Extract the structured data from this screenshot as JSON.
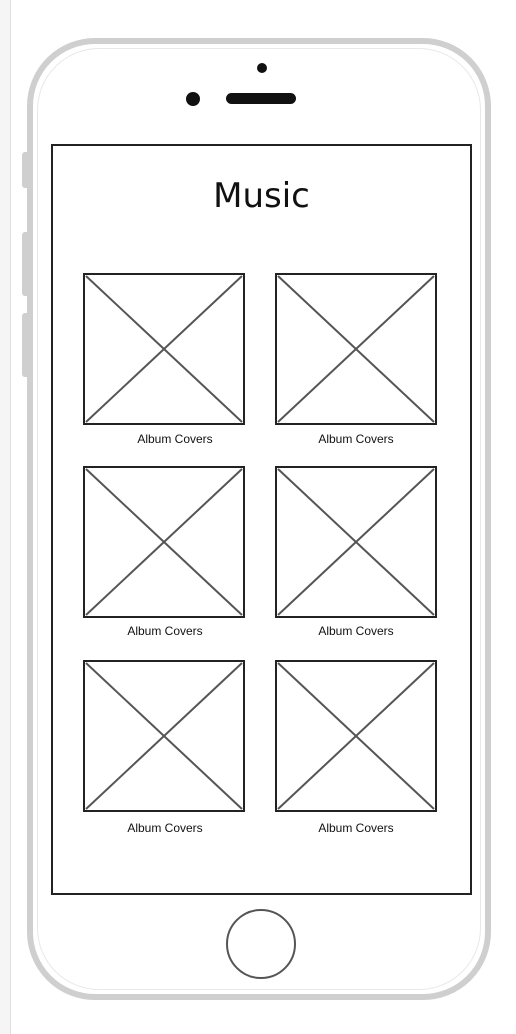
{
  "screen": {
    "title": "Music"
  },
  "albums": [
    {
      "caption": "Album Covers"
    },
    {
      "caption": "Album Covers"
    },
    {
      "caption": "Album Covers"
    },
    {
      "caption": "Album Covers"
    },
    {
      "caption": "Album Covers"
    },
    {
      "caption": "Album Covers"
    }
  ],
  "icons": {
    "placeholder": "image-placeholder-icon",
    "home": "home-button-icon"
  },
  "colors": {
    "frame": "#cfcfcf",
    "outline": "#222222",
    "placeholder_cross": "#555555"
  }
}
